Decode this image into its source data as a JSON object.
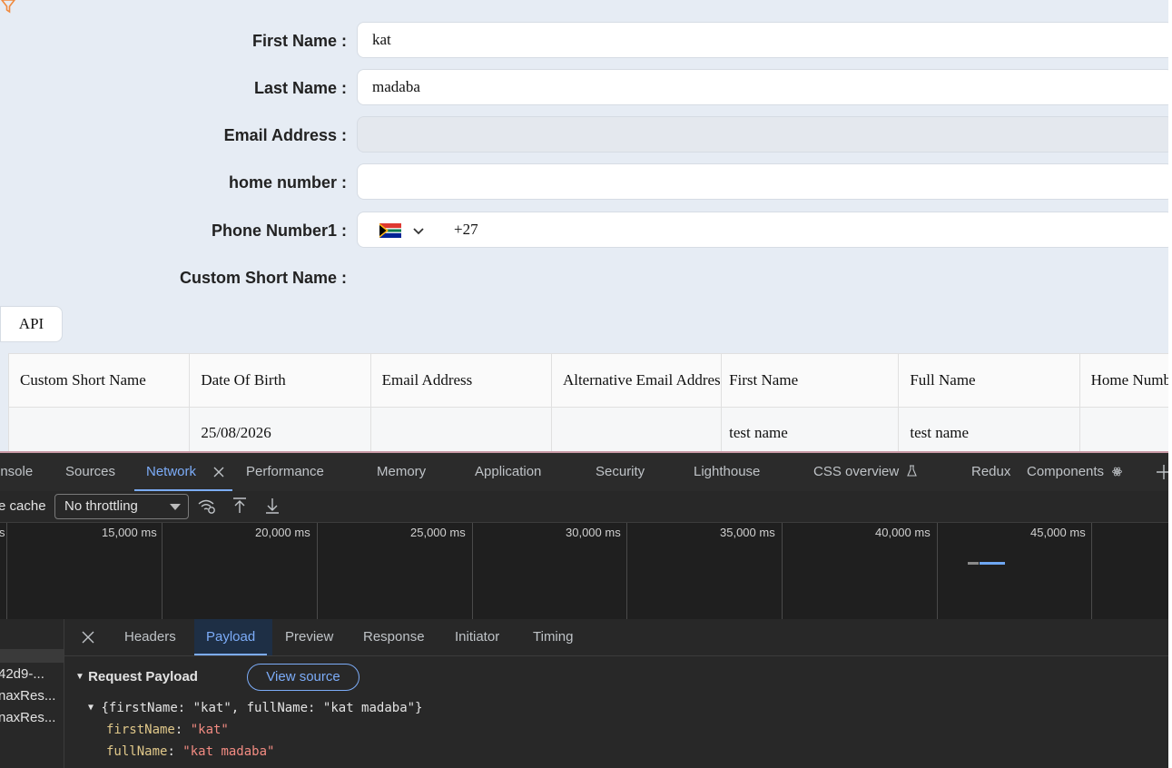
{
  "form": {
    "fields": [
      {
        "label": "First Name :",
        "value": "kat"
      },
      {
        "label": "Last Name :",
        "value": "madaba"
      },
      {
        "label": "Email Address :",
        "value": ""
      },
      {
        "label": "home number :",
        "value": ""
      },
      {
        "label": "Phone Number1 :",
        "country_code": "+27",
        "flag": "south-africa-flag-icon"
      },
      {
        "label": "Custom Short Name :"
      }
    ],
    "api_button": "API"
  },
  "table": {
    "headers": [
      "Custom Short Name",
      "Date Of Birth",
      "Email Address",
      "Alternative Email Address",
      "First Name",
      "Full Name",
      "Home Number"
    ],
    "rows": [
      [
        "",
        "25/08/2026",
        "",
        "",
        "test name",
        "test name",
        ""
      ]
    ]
  },
  "devtools": {
    "tabs": [
      "onsole",
      "Sources",
      "Network",
      "Performance",
      "Memory",
      "Application",
      "Security",
      "Lighthouse",
      "CSS overview",
      "Redux",
      "Components"
    ],
    "active_tab": "Network",
    "toolbar": {
      "disable_cache_label": "e cache",
      "throttling": "No throttling"
    },
    "timeline_labels": [
      "s",
      "15,000 ms",
      "20,000 ms",
      "25,000 ms",
      "30,000 ms",
      "35,000 ms",
      "40,000 ms",
      "45,000 ms"
    ],
    "requests": [
      "42d9-...",
      "naxRes...",
      "naxRes..."
    ],
    "detail_tabs": [
      "Headers",
      "Payload",
      "Preview",
      "Response",
      "Initiator",
      "Timing"
    ],
    "active_detail_tab": "Payload",
    "payload": {
      "section_title": "Request Payload",
      "view_source": "View source",
      "summary": "{firstName: \"kat\", fullName: \"kat madaba\"}",
      "entries": [
        {
          "key": "firstName",
          "value": "\"kat\""
        },
        {
          "key": "fullName",
          "value": "\"kat madaba\""
        }
      ]
    }
  }
}
